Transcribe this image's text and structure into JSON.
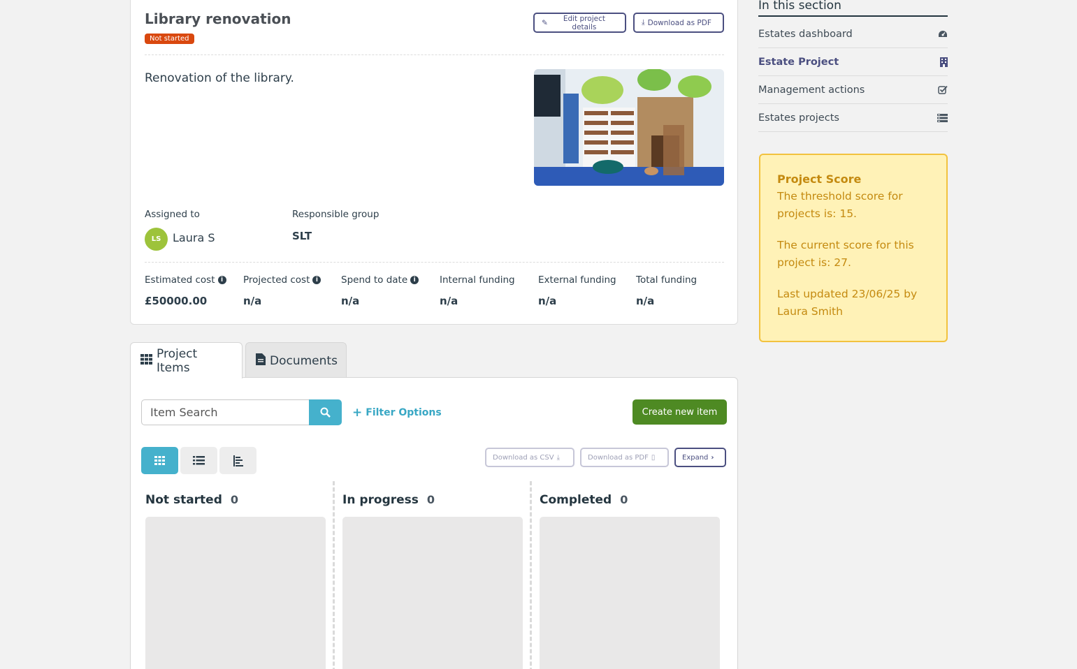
{
  "project": {
    "title": "Library renovation",
    "status": "Not started",
    "edit_label": "Edit project details",
    "pdf_label": "Download as PDF",
    "description": "Renovation of the library.",
    "assigned_label": "Assigned to",
    "assignee_initials": "LS",
    "assignee_name": "Laura S",
    "group_label": "Responsible group",
    "group_value": "SLT",
    "costs": [
      {
        "label": "Estimated cost",
        "value": "£50000.00"
      },
      {
        "label": "Projected cost",
        "value": "n/a"
      },
      {
        "label": "Spend to date",
        "value": "n/a"
      },
      {
        "label": "Internal funding",
        "value": "n/a"
      },
      {
        "label": "External funding",
        "value": "n/a"
      },
      {
        "label": "Total funding",
        "value": "n/a"
      }
    ]
  },
  "tabs": [
    {
      "label": "Project Items",
      "icon": "grid-icon"
    },
    {
      "label": "Documents",
      "icon": "file-icon"
    }
  ],
  "items": {
    "search_placeholder": "Item Search",
    "filter_label": "Filter Options",
    "create_label": "Create new item",
    "csv_label": "Download as CSV",
    "pdf_label": "Download as PDF",
    "expand_label": "Expand",
    "columns": [
      {
        "title": "Not started",
        "count": "0"
      },
      {
        "title": "In progress",
        "count": "0"
      },
      {
        "title": "Completed",
        "count": "0"
      }
    ]
  },
  "sidebar": {
    "title": "In this section",
    "items": [
      {
        "label": "Estates dashboard",
        "icon": "dashboard-icon"
      },
      {
        "label": "Estate Project",
        "icon": "building-icon"
      },
      {
        "label": "Management actions",
        "icon": "checkbox-icon"
      },
      {
        "label": "Estates projects",
        "icon": "list-icon"
      }
    ]
  },
  "score": {
    "title": "Project Score",
    "threshold": "The threshold score for projects is: 15.",
    "current": "The current score for this project is: 27.",
    "updated": "Last updated 23/06/25 by Laura Smith"
  },
  "colors": {
    "accent": "#45b1cc",
    "primary": "#4b4f80",
    "success": "#4e8a23",
    "danger": "#d9480f",
    "warning_bg": "#fff2b7"
  }
}
